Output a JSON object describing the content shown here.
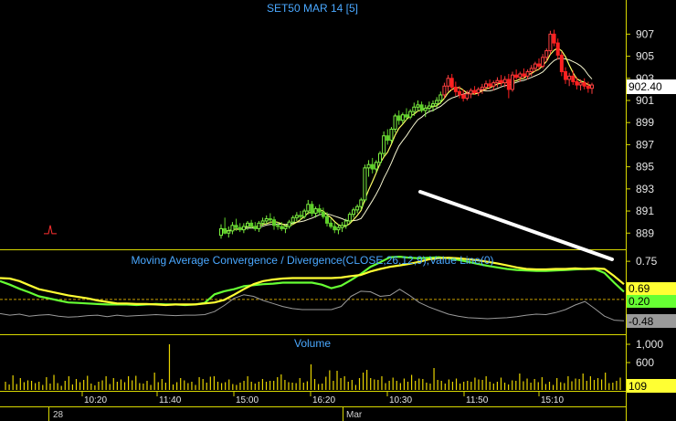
{
  "chart_data": [
    {
      "type": "candlestick",
      "title": "SET50 MAR 14   [5]",
      "y_ticks": [
        889,
        891,
        893,
        895,
        897,
        899,
        901,
        903,
        905,
        907
      ],
      "ylim": [
        887.7,
        908.6
      ],
      "last_price": "902.40",
      "colors": {
        "up": "#7cf040",
        "down": "#ff2020",
        "ma_fast": "#ffff66",
        "ma_slow": "#f5f5d0",
        "trendline": "#ffffff"
      },
      "candles": [
        [
          888.8,
          889.8,
          888.5,
          889.4
        ],
        [
          889.4,
          890.4,
          888.9,
          889.0
        ],
        [
          889.0,
          889.6,
          888.6,
          889.2
        ],
        [
          889.2,
          890.0,
          888.9,
          889.7
        ],
        [
          889.7,
          890.3,
          889.2,
          889.5
        ],
        [
          889.5,
          889.9,
          889.1,
          889.3
        ],
        [
          889.3,
          889.9,
          889.0,
          889.6
        ],
        [
          889.6,
          890.1,
          889.3,
          889.9
        ],
        [
          889.9,
          890.2,
          889.4,
          889.6
        ],
        [
          889.6,
          890.0,
          889.2,
          889.4
        ],
        [
          889.4,
          890.1,
          889.1,
          889.9
        ],
        [
          889.9,
          890.4,
          889.6,
          890.1
        ],
        [
          890.1,
          890.6,
          889.8,
          890.3
        ],
        [
          890.3,
          890.8,
          889.9,
          890.2
        ],
        [
          890.2,
          890.5,
          889.3,
          889.7
        ],
        [
          889.7,
          890.0,
          889.3,
          889.6
        ],
        [
          889.6,
          890.0,
          889.2,
          889.4
        ],
        [
          889.4,
          889.8,
          889.0,
          889.6
        ],
        [
          889.6,
          890.2,
          889.4,
          890.0
        ],
        [
          890.0,
          890.6,
          889.8,
          890.4
        ],
        [
          890.4,
          890.9,
          890.1,
          890.6
        ],
        [
          890.6,
          891.0,
          890.2,
          890.5
        ],
        [
          890.5,
          891.2,
          890.3,
          891.0
        ],
        [
          891.0,
          892.0,
          890.7,
          891.6
        ],
        [
          891.6,
          891.9,
          890.5,
          890.8
        ],
        [
          890.8,
          891.4,
          890.4,
          891.2
        ],
        [
          891.2,
          891.6,
          890.6,
          890.9
        ],
        [
          890.9,
          891.3,
          890.3,
          890.5
        ],
        [
          890.5,
          890.9,
          889.6,
          889.9
        ],
        [
          889.9,
          890.3,
          889.4,
          889.6
        ],
        [
          889.6,
          890.0,
          889.0,
          889.3
        ],
        [
          889.3,
          889.8,
          888.9,
          889.5
        ],
        [
          889.5,
          890.0,
          889.1,
          889.7
        ],
        [
          889.7,
          890.3,
          889.4,
          890.1
        ],
        [
          890.1,
          890.9,
          889.9,
          890.7
        ],
        [
          890.7,
          891.3,
          890.4,
          891.1
        ],
        [
          891.1,
          891.6,
          890.8,
          891.4
        ],
        [
          891.4,
          892.2,
          891.1,
          892.0
        ],
        [
          892.0,
          895.2,
          891.8,
          894.9
        ],
        [
          894.9,
          895.6,
          894.1,
          895.2
        ],
        [
          895.2,
          895.8,
          894.4,
          894.8
        ],
        [
          894.8,
          895.6,
          894.5,
          895.4
        ],
        [
          895.4,
          896.4,
          895.1,
          896.2
        ],
        [
          896.2,
          898.2,
          895.9,
          897.8
        ],
        [
          897.8,
          898.4,
          897.0,
          897.4
        ],
        [
          897.4,
          898.6,
          897.1,
          898.4
        ],
        [
          898.4,
          899.8,
          898.1,
          899.6
        ],
        [
          899.6,
          900.1,
          898.8,
          899.2
        ],
        [
          899.2,
          899.9,
          898.9,
          899.7
        ],
        [
          899.7,
          900.3,
          899.2,
          899.5
        ],
        [
          899.5,
          900.2,
          899.3,
          900.0
        ],
        [
          900.0,
          900.8,
          899.6,
          900.4
        ],
        [
          900.4,
          901.0,
          900.0,
          900.6
        ],
        [
          900.6,
          900.9,
          899.9,
          900.1
        ],
        [
          900.1,
          900.6,
          899.5,
          900.3
        ],
        [
          900.3,
          900.9,
          899.9,
          900.5
        ],
        [
          900.5,
          901.0,
          900.0,
          900.7
        ],
        [
          900.7,
          901.3,
          900.3,
          901.0
        ],
        [
          901.0,
          901.8,
          900.7,
          901.5
        ],
        [
          901.5,
          902.6,
          901.2,
          902.3
        ],
        [
          902.3,
          903.3,
          901.8,
          903.0
        ],
        [
          903.0,
          903.4,
          901.9,
          902.2
        ],
        [
          902.2,
          902.7,
          901.4,
          901.8
        ],
        [
          901.8,
          902.3,
          901.2,
          901.5
        ],
        [
          901.5,
          902.0,
          900.9,
          901.2
        ],
        [
          901.2,
          901.9,
          901.0,
          901.6
        ],
        [
          901.6,
          902.1,
          901.2,
          901.9
        ],
        [
          901.9,
          902.3,
          901.5,
          901.7
        ],
        [
          901.7,
          902.2,
          901.4,
          902.0
        ],
        [
          902.0,
          902.5,
          901.6,
          902.2
        ],
        [
          902.2,
          902.8,
          901.9,
          902.5
        ],
        [
          902.5,
          902.9,
          902.0,
          902.3
        ],
        [
          902.3,
          902.8,
          901.9,
          902.6
        ],
        [
          902.6,
          903.1,
          902.2,
          902.8
        ],
        [
          902.8,
          903.3,
          902.3,
          902.6
        ],
        [
          902.6,
          903.2,
          902.2,
          902.9
        ],
        [
          902.9,
          903.4,
          901.2,
          902.0
        ],
        [
          902.0,
          903.6,
          901.8,
          903.3
        ],
        [
          903.3,
          903.8,
          902.9,
          903.1
        ],
        [
          903.1,
          903.6,
          902.7,
          903.4
        ],
        [
          903.4,
          903.9,
          903.0,
          903.2
        ],
        [
          903.2,
          903.8,
          902.9,
          903.6
        ],
        [
          903.6,
          904.2,
          903.2,
          903.9
        ],
        [
          903.9,
          904.5,
          903.6,
          904.3
        ],
        [
          904.3,
          904.8,
          903.8,
          904.1
        ],
        [
          904.1,
          905.2,
          903.9,
          904.9
        ],
        [
          904.9,
          905.7,
          904.5,
          905.5
        ],
        [
          905.5,
          907.3,
          905.2,
          907.0
        ],
        [
          907.0,
          907.4,
          905.9,
          906.2
        ],
        [
          906.2,
          906.6,
          904.7,
          905.1
        ],
        [
          905.1,
          905.4,
          903.2,
          903.6
        ],
        [
          903.6,
          904.0,
          902.5,
          902.9
        ],
        [
          902.9,
          903.5,
          902.3,
          903.2
        ],
        [
          903.2,
          903.7,
          902.4,
          902.7
        ],
        [
          902.7,
          903.1,
          902.0,
          902.4
        ],
        [
          902.4,
          902.9,
          901.9,
          902.6
        ],
        [
          902.6,
          903.0,
          902.0,
          902.3
        ],
        [
          902.3,
          902.7,
          901.7,
          902.1
        ],
        [
          902.1,
          902.6,
          901.6,
          902.4
        ]
      ]
    },
    {
      "type": "line",
      "title": "Moving Average Convergence / Divergence(CLOSE,26,12,9),Value Line(0)",
      "y_ticks": [
        "0.75"
      ],
      "ylim": [
        -0.65,
        0.95
      ],
      "values_shown": [
        "0.69",
        "0.20",
        "-0.48"
      ],
      "colors": {
        "macd": "#ffff33",
        "signal": "#66ff33",
        "histogram": "#9a9a9a",
        "zero": "#c8a000"
      },
      "series": [
        {
          "values": [
            0.42,
            0.41,
            0.36,
            0.28,
            0.2,
            0.16,
            0.12,
            0.08,
            0.05,
            0.02,
            -0.02,
            -0.05,
            -0.08,
            -0.08,
            -0.09,
            -0.09,
            -0.1,
            -0.11,
            -0.1,
            -0.1,
            -0.1,
            -0.08,
            -0.06,
            -0.01,
            0.09,
            0.2,
            0.3,
            0.36,
            0.39,
            0.41,
            0.42,
            0.42,
            0.42,
            0.42,
            0.42,
            0.43,
            0.46,
            0.48,
            0.55,
            0.6,
            0.64,
            0.67,
            0.7,
            0.74,
            0.79,
            0.81,
            0.82,
            0.81,
            0.79,
            0.77,
            0.74,
            0.71,
            0.67,
            0.63,
            0.6,
            0.59,
            0.59,
            0.6,
            0.6,
            0.61,
            0.6,
            0.61,
            0.6,
            0.46,
            0.3
          ]
        },
        {
          "values": [
            0.36,
            0.29,
            0.21,
            0.14,
            0.06,
            0.02,
            -0.02,
            -0.06,
            -0.07,
            -0.08,
            -0.09,
            -0.1,
            -0.1,
            -0.1,
            -0.11,
            -0.1,
            -0.09,
            -0.1,
            -0.1,
            -0.11,
            -0.1,
            -0.07,
            0.1,
            0.16,
            0.2,
            0.26,
            0.28,
            0.3,
            0.31,
            0.33,
            0.33,
            0.33,
            0.33,
            0.29,
            0.22,
            0.27,
            0.38,
            0.5,
            0.64,
            0.73,
            0.83,
            0.84,
            0.82,
            0.81,
            0.82,
            0.83,
            0.81,
            0.78,
            0.74,
            0.7,
            0.66,
            0.63,
            0.6,
            0.58,
            0.57,
            0.56,
            0.56,
            0.57,
            0.58,
            0.59,
            0.6,
            0.6,
            0.52,
            0.33,
            0.15
          ]
        },
        {
          "values": [
            -0.28,
            -0.31,
            -0.29,
            -0.33,
            -0.31,
            -0.3,
            -0.33,
            -0.35,
            -0.34,
            -0.32,
            -0.31,
            -0.34,
            -0.31,
            -0.33,
            -0.32,
            -0.31,
            -0.3,
            -0.31,
            -0.32,
            -0.31,
            -0.31,
            -0.3,
            -0.24,
            -0.12,
            0.02,
            0.09,
            0.06,
            -0.02,
            -0.08,
            -0.14,
            -0.18,
            -0.2,
            -0.2,
            -0.2,
            -0.2,
            -0.14,
            0.06,
            0.16,
            0.15,
            0.06,
            0.08,
            0.2,
            0.08,
            -0.06,
            -0.15,
            -0.22,
            -0.29,
            -0.33,
            -0.36,
            -0.37,
            -0.38,
            -0.37,
            -0.36,
            -0.34,
            -0.31,
            -0.29,
            -0.3,
            -0.26,
            -0.2,
            -0.11,
            -0.04,
            -0.18,
            -0.33,
            -0.41,
            -0.42
          ]
        }
      ]
    },
    {
      "type": "bar",
      "title": "Volume",
      "y_ticks": [
        "1,000",
        "600"
      ],
      "ylim": [
        0,
        1180
      ],
      "last_value": "109",
      "color": "#e8d400",
      "values": [
        180,
        120,
        320,
        130,
        260,
        170,
        210,
        200,
        150,
        180,
        110,
        280,
        140,
        330,
        150,
        90,
        200,
        300,
        120,
        240,
        170,
        220,
        310,
        140,
        100,
        180,
        210,
        300,
        130,
        260,
        180,
        230,
        170,
        300,
        210,
        310,
        150,
        140,
        200,
        110,
        380,
        170,
        240,
        160,
        1000,
        120,
        170,
        260,
        210,
        150,
        180,
        110,
        280,
        240,
        160,
        290,
        300,
        180,
        150,
        170,
        230,
        130,
        110,
        160,
        200,
        300,
        180,
        140,
        180,
        240,
        180,
        200,
        200,
        280,
        340,
        220,
        170,
        160,
        150,
        260,
        160,
        190,
        560,
        240,
        130,
        140,
        290,
        430,
        200,
        420,
        260,
        300,
        180,
        220,
        110,
        260,
        380,
        440,
        260,
        230,
        220,
        300,
        150,
        200,
        270,
        200,
        150,
        250,
        180,
        330,
        200,
        250,
        240,
        160,
        140,
        480,
        220,
        200,
        140,
        230,
        180,
        250,
        140,
        180,
        200,
        180,
        270,
        230,
        220,
        300,
        180,
        140,
        180,
        270,
        160,
        120,
        210,
        200,
        360,
        190,
        250,
        160,
        240,
        170,
        280,
        130,
        180,
        110,
        260,
        170,
        150,
        300,
        190,
        250,
        240,
        360,
        200,
        300,
        220,
        260,
        230,
        380,
        150,
        160,
        200,
        270
      ]
    }
  ],
  "time_axis": {
    "labels": [
      "10:20",
      "11:40",
      "15:00",
      "16:20",
      "10:30",
      "11:50",
      "15:10"
    ],
    "date_labels": [
      "28",
      "Mar"
    ]
  }
}
